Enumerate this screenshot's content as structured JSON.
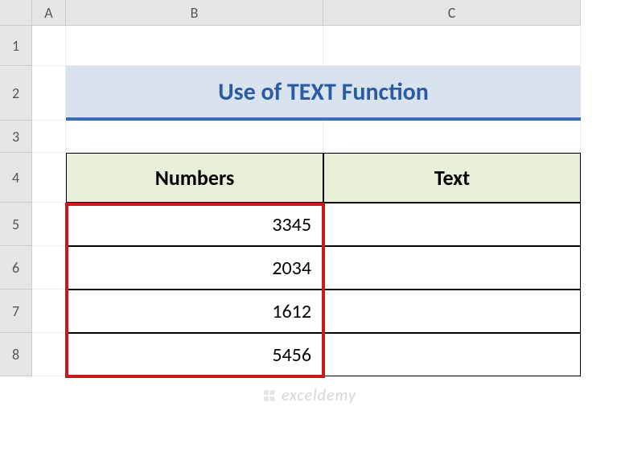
{
  "columns": [
    "A",
    "B",
    "C"
  ],
  "rows": [
    "1",
    "2",
    "3",
    "4",
    "5",
    "6",
    "7",
    "8"
  ],
  "title": "Use of TEXT Function",
  "headers": {
    "numbers": "Numbers",
    "text": "Text"
  },
  "data": {
    "numbers": [
      "3345",
      "2034",
      "1612",
      "5456"
    ],
    "text": [
      "",
      "",
      "",
      ""
    ]
  },
  "colors": {
    "title_bg": "#d9e3f0",
    "title_fg": "#2b5ba0",
    "title_underline": "#3a6fb5",
    "header_bg": "#e8f0da",
    "highlight": "#c81a1a"
  },
  "watermark": "exceldemy"
}
